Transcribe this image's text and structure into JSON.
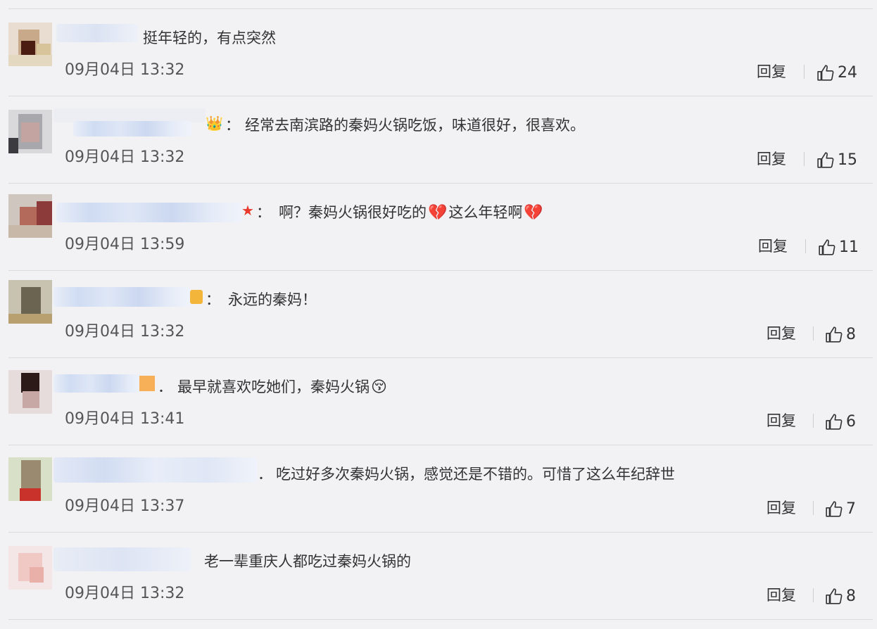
{
  "comments": [
    {
      "text": "挺年轻的，有点突然",
      "time": "09月04日 13:32",
      "reply": "回复",
      "likes": "24",
      "badge": "",
      "emojis": []
    },
    {
      "text": "经常去南滨路的秦妈火锅吃饭，味道很好，很喜欢。",
      "time": "09月04日 13:32",
      "reply": "回复",
      "likes": "15",
      "badge": "👑",
      "separator": "：",
      "emojis": []
    },
    {
      "text_a": "啊？秦妈火锅很好吃的",
      "text_b": "这么年轻啊",
      "time": "09月04日 13:59",
      "reply": "回复",
      "likes": "11",
      "badge": "★",
      "separator": "：",
      "emojis": [
        "💔",
        "💔"
      ]
    },
    {
      "text": "永远的秦妈！",
      "time": "09月04日 13:32",
      "reply": "回复",
      "likes": "8",
      "badge": "",
      "separator": "：",
      "emojis": []
    },
    {
      "text": "最早就喜欢吃她们，秦妈火锅",
      "time": "09月04日 13:41",
      "reply": "回复",
      "likes": "6",
      "separator": "．",
      "emojis": [
        "😚"
      ]
    },
    {
      "text": "吃过好多次秦妈火锅，感觉还是不错的。可惜了这么年纪辞世",
      "time": "09月04日 13:37",
      "reply": "回复",
      "likes": "7",
      "separator": "．",
      "emojis": []
    },
    {
      "text": "老一辈重庆人都吃过秦妈火锅的",
      "time": "09月04日 13:32",
      "reply": "回复",
      "likes": "8",
      "emojis": []
    }
  ],
  "colors": {
    "background": "#f2f2f5",
    "divider": "#dcdcdf",
    "text": "#333333",
    "nickname_blur": "#cfdcf2"
  },
  "icons": {
    "like": "thumbs-up-icon"
  }
}
